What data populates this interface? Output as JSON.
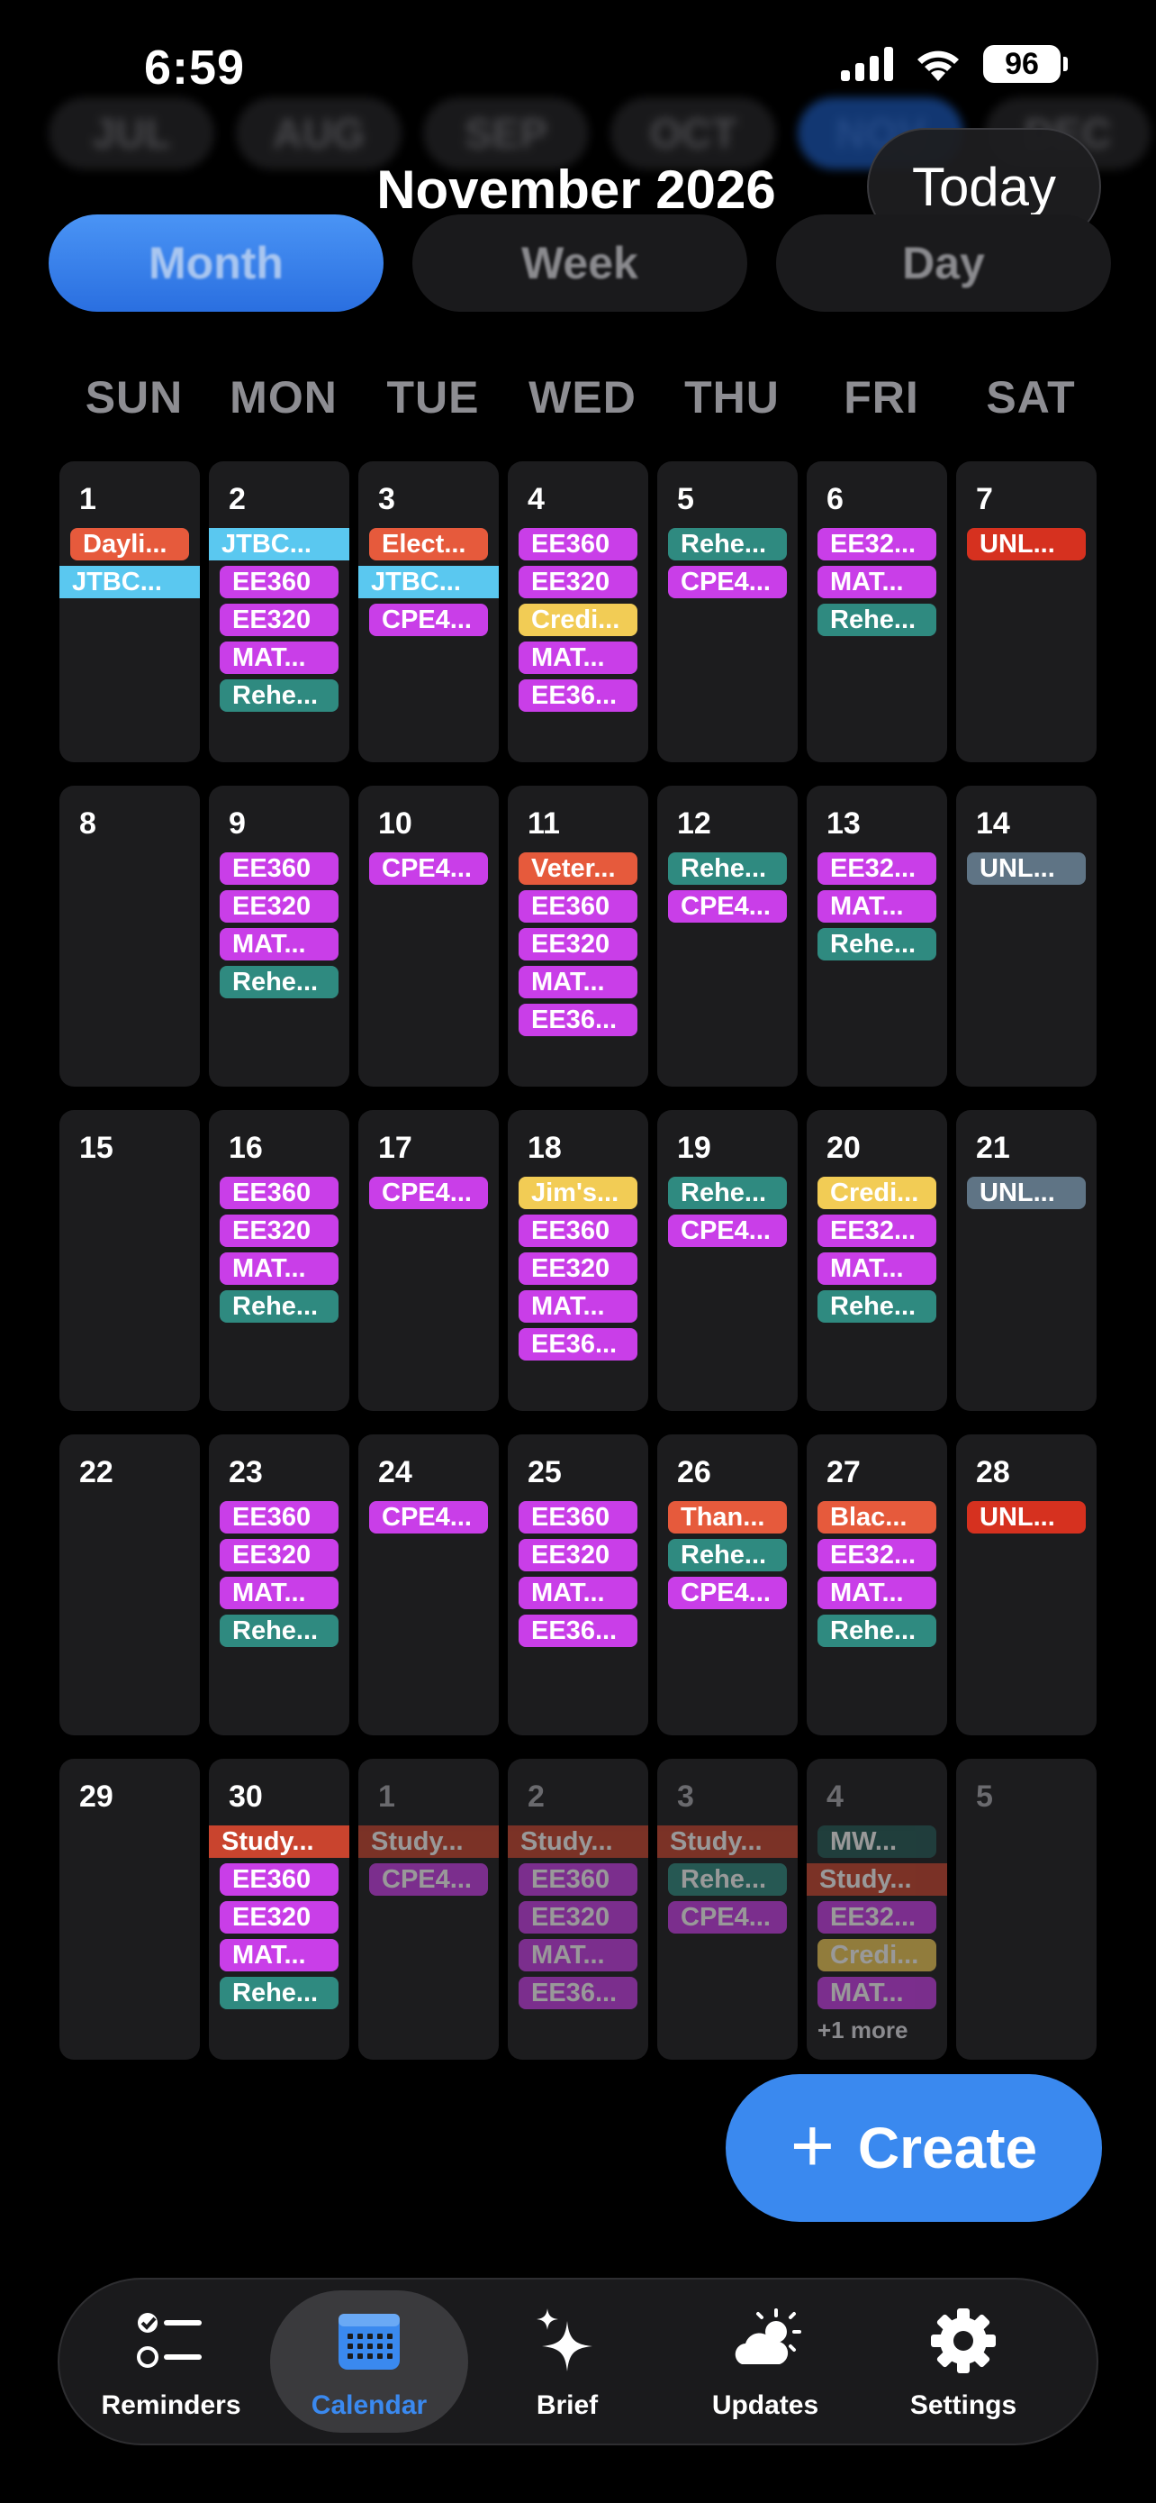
{
  "status": {
    "time": "6:59",
    "battery": "96"
  },
  "months": [
    "JUL",
    "AUG",
    "SEP",
    "OCT",
    "NOV",
    "DEC"
  ],
  "header": {
    "title": "November 2026",
    "today_label": "Today"
  },
  "views": [
    "Month",
    "Week",
    "Day"
  ],
  "active_view": "Month",
  "weekdays": [
    "SUN",
    "MON",
    "TUE",
    "WED",
    "THU",
    "FRI",
    "SAT"
  ],
  "colors": {
    "accent": "#3a89ef",
    "purple": "#c93ee8",
    "teal": "#2f8a80",
    "orange": "#e65a3c",
    "cyan": "#5ac8f0",
    "yellow": "#f2cc55",
    "red": "#d6311f",
    "slate": "#5f7485"
  },
  "days": [
    {
      "day": "1",
      "events": [
        {
          "t": "Dayli...",
          "c": "orange"
        },
        {
          "t": "JTBC...",
          "c": "cyan",
          "full": true
        }
      ]
    },
    {
      "day": "2",
      "events": [
        {
          "t": "JTBC...",
          "c": "cyan",
          "full": true
        },
        {
          "t": "EE360",
          "c": "purple"
        },
        {
          "t": "EE320",
          "c": "purple"
        },
        {
          "t": "MAT...",
          "c": "purple"
        },
        {
          "t": "Rehe...",
          "c": "teal"
        }
      ]
    },
    {
      "day": "3",
      "events": [
        {
          "t": "Elect...",
          "c": "orange"
        },
        {
          "t": "JTBC...",
          "c": "cyan",
          "full": true
        },
        {
          "t": "CPE4...",
          "c": "purple"
        }
      ]
    },
    {
      "day": "4",
      "events": [
        {
          "t": "EE360",
          "c": "purple"
        },
        {
          "t": "EE320",
          "c": "purple"
        },
        {
          "t": "Credi...",
          "c": "yellow"
        },
        {
          "t": "MAT...",
          "c": "purple"
        },
        {
          "t": "EE36...",
          "c": "purple"
        }
      ]
    },
    {
      "day": "5",
      "events": [
        {
          "t": "Rehe...",
          "c": "teal"
        },
        {
          "t": "CPE4...",
          "c": "purple"
        }
      ]
    },
    {
      "day": "6",
      "events": [
        {
          "t": "EE32...",
          "c": "purple"
        },
        {
          "t": "MAT...",
          "c": "purple"
        },
        {
          "t": "Rehe...",
          "c": "teal"
        }
      ]
    },
    {
      "day": "7",
      "events": [
        {
          "t": "UNL...",
          "c": "red"
        }
      ]
    },
    {
      "day": "8",
      "events": []
    },
    {
      "day": "9",
      "events": [
        {
          "t": "EE360",
          "c": "purple"
        },
        {
          "t": "EE320",
          "c": "purple"
        },
        {
          "t": "MAT...",
          "c": "purple"
        },
        {
          "t": "Rehe...",
          "c": "teal"
        }
      ]
    },
    {
      "day": "10",
      "events": [
        {
          "t": "CPE4...",
          "c": "purple"
        }
      ]
    },
    {
      "day": "11",
      "events": [
        {
          "t": "Veter...",
          "c": "orange"
        },
        {
          "t": "EE360",
          "c": "purple"
        },
        {
          "t": "EE320",
          "c": "purple"
        },
        {
          "t": "MAT...",
          "c": "purple"
        },
        {
          "t": "EE36...",
          "c": "purple"
        }
      ]
    },
    {
      "day": "12",
      "events": [
        {
          "t": "Rehe...",
          "c": "teal"
        },
        {
          "t": "CPE4...",
          "c": "purple"
        }
      ]
    },
    {
      "day": "13",
      "events": [
        {
          "t": "EE32...",
          "c": "purple"
        },
        {
          "t": "MAT...",
          "c": "purple"
        },
        {
          "t": "Rehe...",
          "c": "teal"
        }
      ]
    },
    {
      "day": "14",
      "events": [
        {
          "t": "UNL...",
          "c": "slate"
        }
      ]
    },
    {
      "day": "15",
      "events": []
    },
    {
      "day": "16",
      "events": [
        {
          "t": "EE360",
          "c": "purple"
        },
        {
          "t": "EE320",
          "c": "purple"
        },
        {
          "t": "MAT...",
          "c": "purple"
        },
        {
          "t": "Rehe...",
          "c": "teal"
        }
      ]
    },
    {
      "day": "17",
      "events": [
        {
          "t": "CPE4...",
          "c": "purple"
        }
      ]
    },
    {
      "day": "18",
      "events": [
        {
          "t": "Jim's...",
          "c": "yellow"
        },
        {
          "t": "EE360",
          "c": "purple"
        },
        {
          "t": "EE320",
          "c": "purple"
        },
        {
          "t": "MAT...",
          "c": "purple"
        },
        {
          "t": "EE36...",
          "c": "purple"
        }
      ]
    },
    {
      "day": "19",
      "events": [
        {
          "t": "Rehe...",
          "c": "teal"
        },
        {
          "t": "CPE4...",
          "c": "purple"
        }
      ]
    },
    {
      "day": "20",
      "events": [
        {
          "t": "Credi...",
          "c": "yellow"
        },
        {
          "t": "EE32...",
          "c": "purple"
        },
        {
          "t": "MAT...",
          "c": "purple"
        },
        {
          "t": "Rehe...",
          "c": "teal"
        }
      ]
    },
    {
      "day": "21",
      "events": [
        {
          "t": "UNL...",
          "c": "slate"
        }
      ]
    },
    {
      "day": "22",
      "events": []
    },
    {
      "day": "23",
      "events": [
        {
          "t": "EE360",
          "c": "purple"
        },
        {
          "t": "EE320",
          "c": "purple"
        },
        {
          "t": "MAT...",
          "c": "purple"
        },
        {
          "t": "Rehe...",
          "c": "teal"
        }
      ]
    },
    {
      "day": "24",
      "events": [
        {
          "t": "CPE4...",
          "c": "purple"
        }
      ]
    },
    {
      "day": "25",
      "events": [
        {
          "t": "EE360",
          "c": "purple"
        },
        {
          "t": "EE320",
          "c": "purple"
        },
        {
          "t": "MAT...",
          "c": "purple"
        },
        {
          "t": "EE36...",
          "c": "purple"
        }
      ]
    },
    {
      "day": "26",
      "events": [
        {
          "t": "Than...",
          "c": "orange"
        },
        {
          "t": "Rehe...",
          "c": "teal"
        },
        {
          "t": "CPE4...",
          "c": "purple"
        }
      ]
    },
    {
      "day": "27",
      "events": [
        {
          "t": "Blac...",
          "c": "orange"
        },
        {
          "t": "EE32...",
          "c": "purple"
        },
        {
          "t": "MAT...",
          "c": "purple"
        },
        {
          "t": "Rehe...",
          "c": "teal"
        }
      ]
    },
    {
      "day": "28",
      "events": [
        {
          "t": "UNL...",
          "c": "red"
        }
      ]
    },
    {
      "day": "29",
      "events": []
    },
    {
      "day": "30",
      "events": [
        {
          "t": "Study...",
          "c": "darkred",
          "full": true
        },
        {
          "t": "EE360",
          "c": "purple"
        },
        {
          "t": "EE320",
          "c": "purple"
        },
        {
          "t": "MAT...",
          "c": "purple"
        },
        {
          "t": "Rehe...",
          "c": "teal"
        }
      ]
    },
    {
      "day": "1",
      "dim": true,
      "events": [
        {
          "t": "Study...",
          "c": "darkred",
          "full": true
        },
        {
          "t": "CPE4...",
          "c": "purple"
        }
      ]
    },
    {
      "day": "2",
      "dim": true,
      "events": [
        {
          "t": "Study...",
          "c": "darkred",
          "full": true
        },
        {
          "t": "EE360",
          "c": "purple"
        },
        {
          "t": "EE320",
          "c": "purple"
        },
        {
          "t": "MAT...",
          "c": "purple"
        },
        {
          "t": "EE36...",
          "c": "purple"
        }
      ]
    },
    {
      "day": "3",
      "dim": true,
      "events": [
        {
          "t": "Study...",
          "c": "darkred",
          "full": true
        },
        {
          "t": "Rehe...",
          "c": "teal"
        },
        {
          "t": "CPE4...",
          "c": "purple"
        }
      ]
    },
    {
      "day": "4",
      "dim": true,
      "more": "+1 more",
      "events": [
        {
          "t": "MW...",
          "c": "darkteal"
        },
        {
          "t": "Study...",
          "c": "darkred",
          "full": true
        },
        {
          "t": "EE32...",
          "c": "purple"
        },
        {
          "t": "Credi...",
          "c": "yellow"
        },
        {
          "t": "MAT...",
          "c": "purple"
        }
      ]
    },
    {
      "day": "5",
      "dim": true,
      "events": []
    }
  ],
  "create_label": "Create",
  "tabs": [
    {
      "label": "Reminders",
      "icon": "reminders-icon"
    },
    {
      "label": "Calendar",
      "icon": "calendar-icon",
      "active": true
    },
    {
      "label": "Brief",
      "icon": "sparkle-icon"
    },
    {
      "label": "Updates",
      "icon": "weather-icon"
    },
    {
      "label": "Settings",
      "icon": "gear-icon"
    }
  ]
}
